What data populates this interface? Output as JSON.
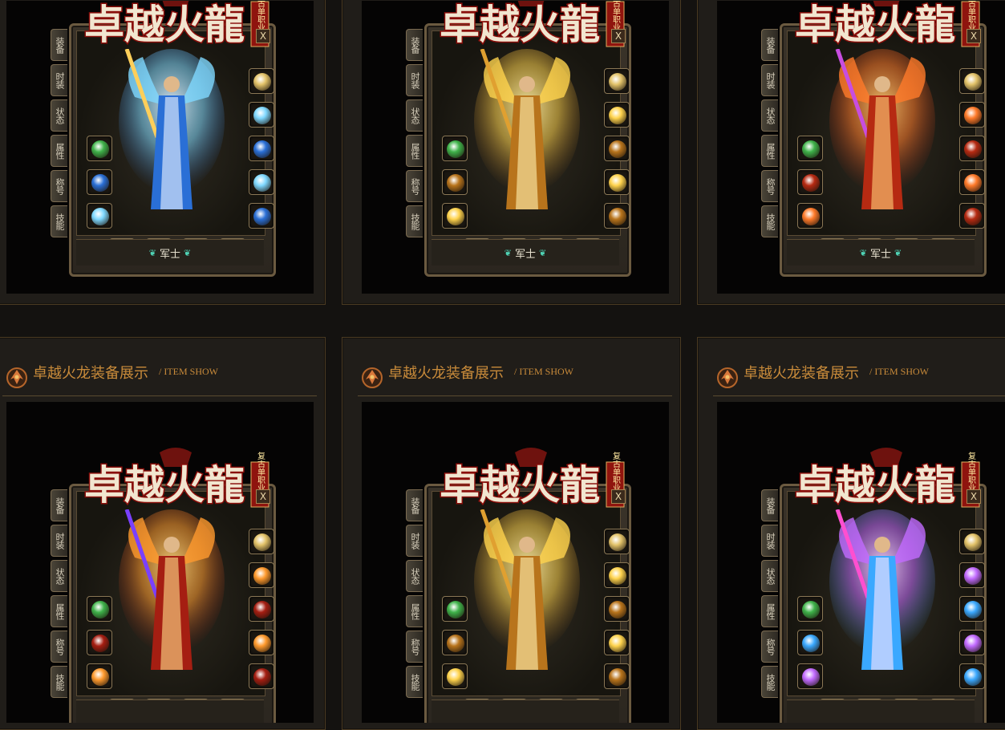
{
  "colors": {
    "page_bg": "#141210",
    "card_bg": "#201d19",
    "accent_text": "#c98b3a",
    "viewport_bg": "#050404"
  },
  "cards": [
    {
      "header": null,
      "logo_text": "卓越火龍",
      "badge": "复古单职业",
      "close": "X",
      "rank": "军士",
      "theme": "ice"
    },
    {
      "header": null,
      "logo_text": "卓越火龍",
      "badge": "复古单职业",
      "close": "X",
      "rank": "军士",
      "theme": "gold"
    },
    {
      "header": null,
      "logo_text": "卓越火龍",
      "badge": "复古单职业",
      "close": "X",
      "rank": "军士",
      "theme": "fire"
    },
    {
      "header": {
        "title": "卓越火龙装备展示",
        "subtitle": "/ ITEM SHOW"
      },
      "logo_text": "卓越火龍",
      "badge": "复古单职业",
      "close": "X",
      "rank": "",
      "theme": "flame"
    },
    {
      "header": {
        "title": "卓越火龙装备展示",
        "subtitle": "/ ITEM SHOW"
      },
      "logo_text": "卓越火龍",
      "badge": "复古单职业",
      "close": "X",
      "rank": "",
      "theme": "gold"
    },
    {
      "header": {
        "title": "卓越火龙装备展示",
        "subtitle": "/ ITEM SHOW"
      },
      "logo_text": "卓越火龍",
      "badge": "复古单职业",
      "close": "X",
      "rank": "",
      "theme": "violet"
    }
  ],
  "side_tabs": [
    "装备",
    "时装",
    "状态",
    "属性",
    "称号",
    "技能"
  ],
  "icons": {
    "emblem": "dragon-emblem-icon",
    "rank_wing": "wing-icon"
  }
}
